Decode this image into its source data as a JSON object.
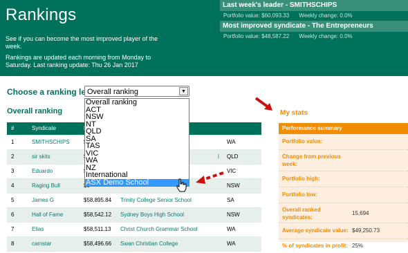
{
  "banner": {
    "title": "Rankings",
    "description": "See if you can become the most improved player of the week.",
    "update_prefix": "Rankings are updated each morning from Monday to Saturday. Last ranking update: Thu 26 Jan 2017"
  },
  "leader": {
    "leader_title": "Last week's leader - SMITHSCHIPS",
    "leader_portfolio": "Portfolio value: $60,093.33",
    "leader_change": "Weekly change: 0.0%",
    "improved_title": "Most improved syndicate - The Entrepreneurs",
    "improved_portfolio": "Portfolio value: $48,587.22",
    "improved_change": "Weekly change: 0.0%"
  },
  "choose": {
    "label": "Choose a ranking level",
    "selected": "Overall ranking",
    "options": [
      "Overall ranking",
      "ACT",
      "NSW",
      "NT",
      "QLD",
      "SA",
      "TAS",
      "VIC",
      "WA",
      "NZ",
      "International",
      "ASX Demo School"
    ],
    "highlighted": "ASX Demo School"
  },
  "overall": {
    "title": "Overall ranking",
    "headers": [
      "#",
      "Syndicate",
      "Po"
    ],
    "rows": [
      {
        "rank": "1",
        "syndicate": "SMITHSCHIPS",
        "portfolio": "$6",
        "school": "",
        "state": "WA"
      },
      {
        "rank": "2",
        "syndicate": "sir skits",
        "portfolio": "$6",
        "school": "l",
        "state": "QLD"
      },
      {
        "rank": "3",
        "syndicate": "Eduardo",
        "portfolio": "$5",
        "school": "",
        "state": "VIC"
      },
      {
        "rank": "4",
        "syndicate": "Raging Bull",
        "portfolio": "$5",
        "school": "",
        "state": "NSW"
      },
      {
        "rank": "5",
        "syndicate": "James G",
        "portfolio": "$58,895.84",
        "school": "Trinity College Senior School",
        "state": "SA"
      },
      {
        "rank": "6",
        "syndicate": "Hall of Fame",
        "portfolio": "$58,542.12",
        "school": "Sydney Boys High School",
        "state": "NSW"
      },
      {
        "rank": "7",
        "syndicate": "Elias",
        "portfolio": "$58,511.13",
        "school": "Christ Church Grammar School",
        "state": "WA"
      },
      {
        "rank": "8",
        "syndicate": "camstar",
        "portfolio": "$58,496.66",
        "school": "Swan Christian College",
        "state": "WA"
      }
    ]
  },
  "stats": {
    "title": "My stats",
    "summary_title": "Performance summary",
    "rows": [
      {
        "label": "Portfolio value:",
        "value": ""
      },
      {
        "label": "Change from previous week:",
        "value": ""
      },
      {
        "label": "Portfolio high:",
        "value": ""
      },
      {
        "label": "Portfolio low:",
        "value": ""
      },
      {
        "label": "Overall ranked syndicates:",
        "value": "15,694"
      },
      {
        "label": "Average syndicate value:",
        "value": "$49,250.73"
      },
      {
        "label": "% of syndicates in profit:",
        "value": "25%"
      }
    ]
  },
  "colors": {
    "brand_green": "#00715a",
    "accent_orange": "#f28c00",
    "highlight_blue": "#3399ff",
    "arrow_red": "#cc1111"
  }
}
